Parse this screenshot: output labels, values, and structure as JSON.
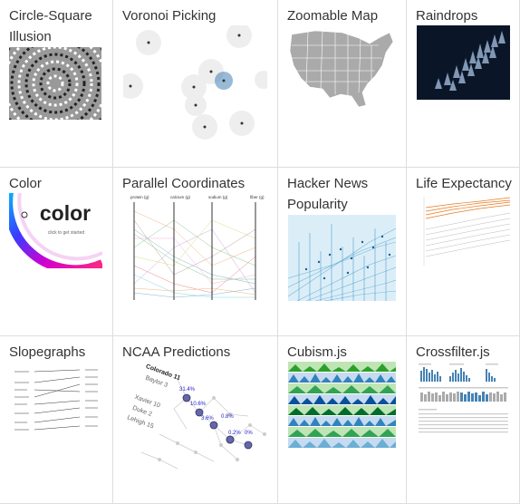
{
  "gallery": {
    "items": [
      {
        "title": "Circle-Square Illusion",
        "thumb_icon": "circle-square-illusion-thumbnail"
      },
      {
        "title": "Voronoi Picking",
        "thumb_icon": "voronoi-picking-thumbnail"
      },
      {
        "title": "Zoomable Map",
        "thumb_icon": "us-map-thumbnail"
      },
      {
        "title": "Raindrops",
        "thumb_icon": "raindrops-thumbnail"
      },
      {
        "title": "Color",
        "thumb_icon": "color-wheel-thumbnail",
        "thumb_text": "color",
        "thumb_subtext": "click to get started"
      },
      {
        "title": "Parallel Coordinates",
        "thumb_icon": "parallel-coordinates-thumbnail",
        "axis_labels": [
          "protein (g)",
          "calcium (g)",
          "sodium (g)",
          "fiber (g)"
        ]
      },
      {
        "title": "Hacker News Popularity",
        "thumb_icon": "hacker-news-scatter-thumbnail"
      },
      {
        "title": "Life Expectancy",
        "thumb_icon": "life-expectancy-thumbnail"
      },
      {
        "title": "Slopegraphs",
        "thumb_icon": "slopegraph-thumbnail"
      },
      {
        "title": "NCAA Predictions",
        "thumb_icon": "ncaa-bracket-thumbnail",
        "labels": [
          "Colorado 11",
          "Baylor 3",
          "Xavier 10",
          "Duke 2",
          "Lehigh 15"
        ],
        "percents": [
          "31.4%",
          "10.6%",
          "3.6%",
          "0.8%",
          "0.2%",
          "0%"
        ]
      },
      {
        "title": "Cubism.js",
        "thumb_icon": "cubism-horizon-thumbnail"
      },
      {
        "title": "Crossfilter.js",
        "thumb_icon": "crossfilter-thumbnail"
      }
    ]
  },
  "colors": {
    "title": "#333333",
    "border": "#dddddd",
    "accent_blue": "#4682b4",
    "orange": "#e6791e",
    "navy": "#0a1628"
  }
}
